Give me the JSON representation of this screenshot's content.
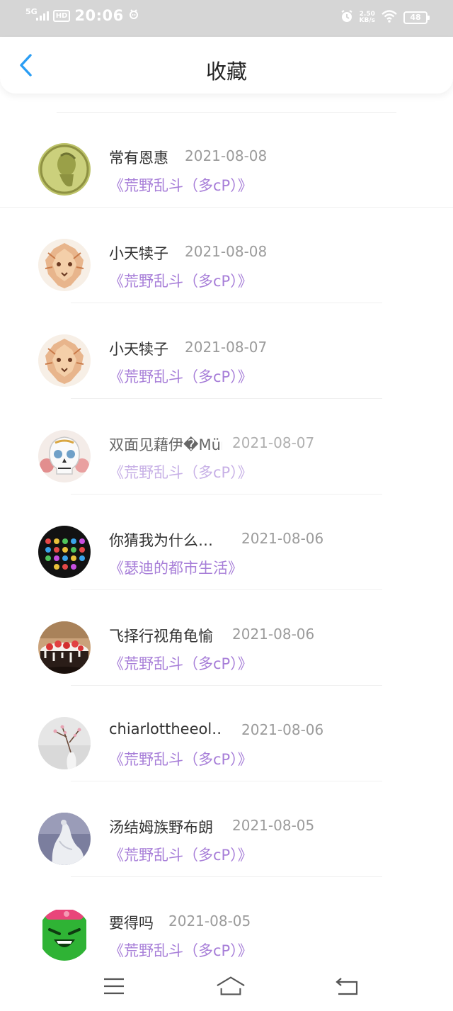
{
  "status_bar": {
    "network": "5G",
    "hd": "HD",
    "time": "20:06",
    "speed_value": "2.50",
    "speed_unit": "KB/s",
    "battery": "48"
  },
  "header": {
    "title": "收藏"
  },
  "favorites": [
    {
      "name": "常有恩惠",
      "date": "2021-08-08",
      "book": "《荒野乱斗（多cP）》"
    },
    {
      "name": "小天犊子",
      "date": "2021-08-08",
      "book": "《荒野乱斗（多cP）》"
    },
    {
      "name": "小天犊子",
      "date": "2021-08-07",
      "book": "《荒野乱斗（多cP）》"
    },
    {
      "name": "双面见藉伊�München",
      "date": "2021-08-07",
      "book": "《荒野乱斗（多cP）》"
    },
    {
      "name": "你猜我为什么…",
      "date": "2021-08-06",
      "book": "《瑟迪的都市生活》"
    },
    {
      "name": "飞择行视角龟愉",
      "date": "2021-08-06",
      "book": "《荒野乱斗（多cP）》"
    },
    {
      "name": "chiarlottheeol…",
      "date": "2021-08-06",
      "book": "《荒野乱斗（多cP）》"
    },
    {
      "name": "汤结姆族野布朗",
      "date": "2021-08-05",
      "book": "《荒野乱斗（多cP）》"
    },
    {
      "name": "要得吗",
      "date": "2021-08-05",
      "book": "《荒野乱斗（多cP）》"
    }
  ],
  "nav": {
    "menu_icon": "menu-icon",
    "home_icon": "home-icon",
    "back_icon": "return-icon"
  },
  "colors": {
    "accent": "#2a9df4",
    "book_title": "#a77ed8",
    "date": "#9b9b9b",
    "status_bar": "#d6d6d6"
  }
}
